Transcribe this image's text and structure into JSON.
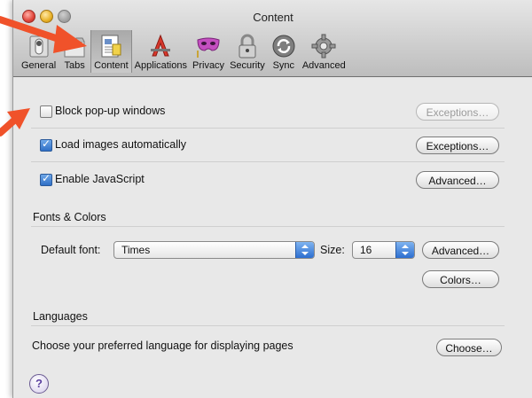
{
  "window": {
    "title": "Content"
  },
  "toolbar": {
    "items": [
      {
        "label": "General",
        "icon": "general-switch-icon"
      },
      {
        "label": "Tabs",
        "icon": "tabs-icon"
      },
      {
        "label": "Content",
        "icon": "content-page-icon",
        "selected": true
      },
      {
        "label": "Applications",
        "icon": "applications-icon"
      },
      {
        "label": "Privacy",
        "icon": "privacy-mask-icon"
      },
      {
        "label": "Security",
        "icon": "padlock-icon"
      },
      {
        "label": "Sync",
        "icon": "sync-icon"
      },
      {
        "label": "Advanced",
        "icon": "gear-icon"
      }
    ]
  },
  "content": {
    "block_popups": {
      "label": "Block pop-up windows",
      "checked": false,
      "button": "Exceptions…",
      "button_enabled": false
    },
    "load_images": {
      "label": "Load images automatically",
      "checked": true,
      "button": "Exceptions…"
    },
    "javascript": {
      "label": "Enable JavaScript",
      "checked": true,
      "button": "Advanced…"
    },
    "fonts_colors": {
      "heading": "Fonts & Colors",
      "default_font_label": "Default font:",
      "default_font_value": "Times",
      "size_label": "Size:",
      "size_value": "16",
      "advanced_button": "Advanced…",
      "colors_button": "Colors…"
    },
    "languages": {
      "heading": "Languages",
      "description": "Choose your preferred language for displaying pages",
      "choose_button": "Choose…"
    },
    "help_label": "?"
  },
  "annotation_color": "#f0522a"
}
